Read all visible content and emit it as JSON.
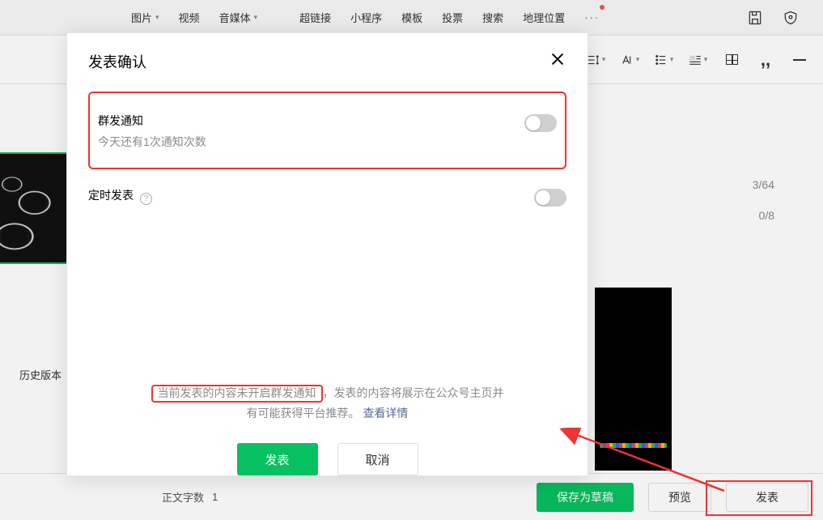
{
  "toolbar": {
    "items": [
      "图片",
      "视频",
      "音媒体",
      "超链接",
      "小程序",
      "模板",
      "投票",
      "搜索",
      "地理位置"
    ],
    "caret_indices": [
      0,
      2
    ],
    "more": "···"
  },
  "counters": {
    "c1": "3/64",
    "c2": "0/8"
  },
  "history_label": "历史版本",
  "bottom": {
    "word_count_label": "正文字数",
    "word_count_value": "1",
    "save_draft": "保存为草稿",
    "preview": "预览",
    "publish": "发表"
  },
  "modal": {
    "title": "发表确认",
    "opt1_title": "群发通知",
    "opt1_sub": "今天还有1次通知次数",
    "opt2_title": "定时发表",
    "note_hl": "当前发表的内容未开启群发通知",
    "note_rest1": "，发表的内容将展示在公众号主页并",
    "note_rest2": "有可能获得平台推荐。",
    "note_link": "查看详情",
    "btn_publish": "发表",
    "btn_cancel": "取消"
  }
}
